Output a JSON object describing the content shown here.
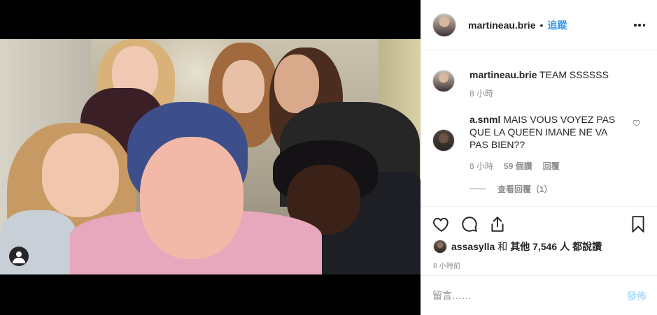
{
  "post": {
    "author": "martineau.brie",
    "separator": "•",
    "follow_label": "追蹤",
    "more_icon": "more-options-icon"
  },
  "caption": {
    "username": "martineau.brie",
    "text": "TEAM SSSSSS",
    "time": "8 小時"
  },
  "comments": [
    {
      "username": "a.snml",
      "text": "MAIS VOUS VOYEZ PAS QUE LA QUEEN IMANE NE VA PAS BIEN??",
      "time": "8 小時",
      "likes": "59 個讚",
      "reply_label": "回覆"
    }
  ],
  "view_replies": "查看回覆（1）",
  "actions": {
    "like_icon": "heart-icon",
    "comment_icon": "comment-icon",
    "share_icon": "share-icon",
    "save_icon": "bookmark-icon"
  },
  "likes": {
    "first_user": "assasylla",
    "and": "和",
    "others": "其他 7,546 人",
    "suffix": "都說讚"
  },
  "timestamp": "8 小時前",
  "add_comment": {
    "placeholder": "留言……",
    "post_label": "發佈"
  },
  "colors": {
    "accent": "#3897f0",
    "post_disabled": "#b2dffc",
    "secondary_text": "#8e8e8e"
  }
}
